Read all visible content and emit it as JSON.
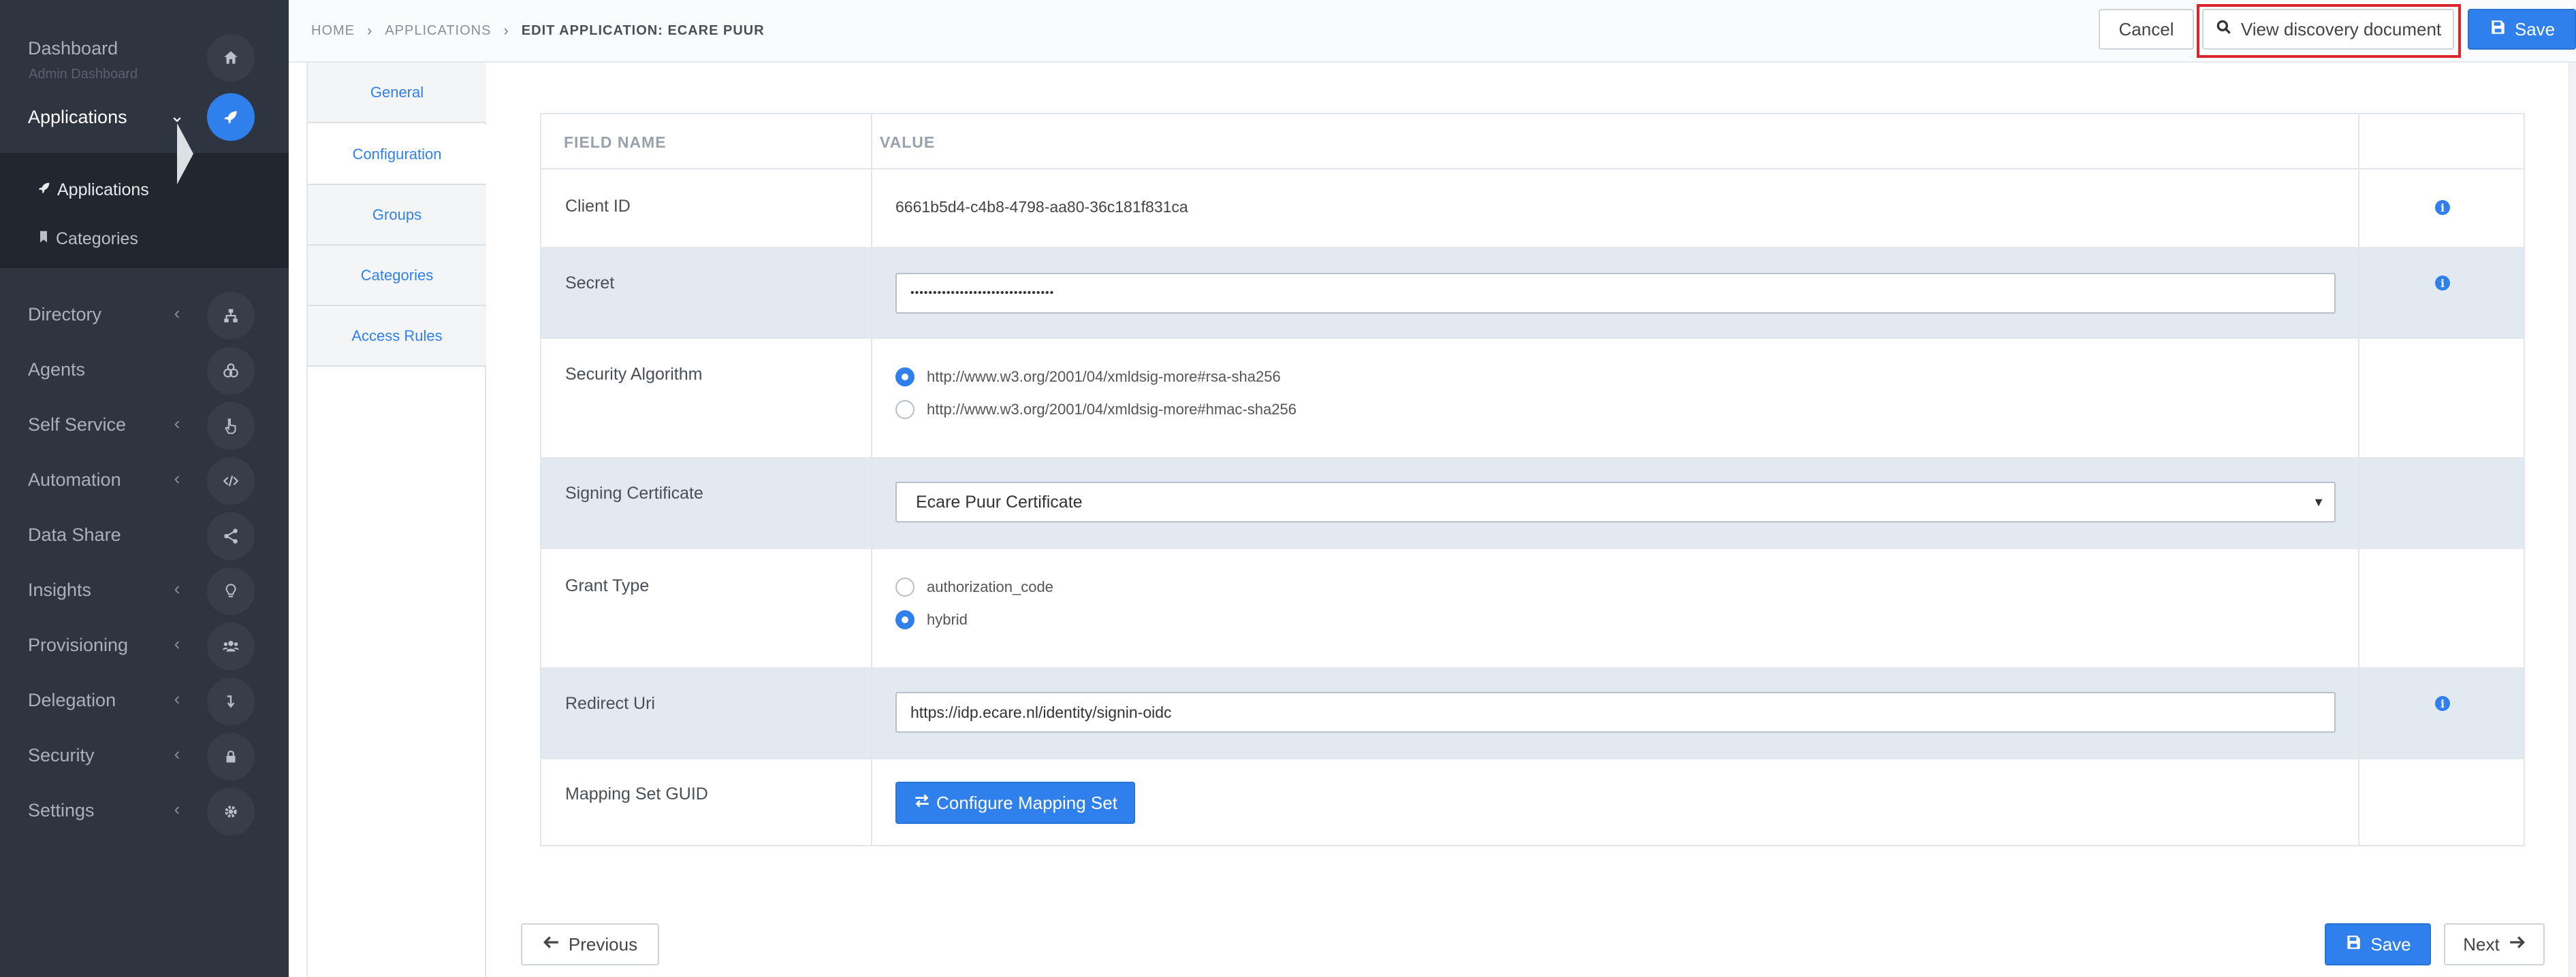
{
  "sidebar": {
    "dashboard": {
      "label": "Dashboard",
      "sub": "Admin Dashboard",
      "icon": "home-icon"
    },
    "applications": {
      "label": "Applications",
      "icon": "rocket-icon"
    },
    "submenu": [
      {
        "label": "Applications",
        "icon": "rocket-icon"
      },
      {
        "label": "Categories",
        "icon": "bookmark-icon"
      }
    ],
    "items": [
      {
        "label": "Directory",
        "icon": "sitemap-icon"
      },
      {
        "label": "Agents",
        "icon": "agents-icon"
      },
      {
        "label": "Self Service",
        "icon": "hand-pointer-icon"
      },
      {
        "label": "Automation",
        "icon": "code-icon"
      },
      {
        "label": "Data Share",
        "icon": "share-icon"
      },
      {
        "label": "Insights",
        "icon": "lightbulb-icon"
      },
      {
        "label": "Provisioning",
        "icon": "users-icon"
      },
      {
        "label": "Delegation",
        "icon": "level-down-icon"
      },
      {
        "label": "Security",
        "icon": "lock-icon"
      },
      {
        "label": "Settings",
        "icon": "gear-icon"
      }
    ]
  },
  "breadcrumb": {
    "home": "HOME",
    "applications": "APPLICATIONS",
    "current": "EDIT APPLICATION: ECARE PUUR"
  },
  "toolbar": {
    "cancel": "Cancel",
    "discovery": "View discovery document",
    "save": "Save"
  },
  "tabs": [
    "General",
    "Configuration",
    "Groups",
    "Categories",
    "Access Rules"
  ],
  "table": {
    "headers": {
      "field": "FIELD NAME",
      "value": "VALUE"
    },
    "client_id": {
      "label": "Client ID",
      "value": "6661b5d4-c4b8-4798-aa80-36c181f831ca"
    },
    "secret": {
      "label": "Secret",
      "value": "••••••••••••••••••••••••••••••••"
    },
    "security_algorithm": {
      "label": "Security Algorithm",
      "options": [
        "http://www.w3.org/2001/04/xmldsig-more#rsa-sha256",
        "http://www.w3.org/2001/04/xmldsig-more#hmac-sha256"
      ],
      "selected": 0
    },
    "signing_certificate": {
      "label": "Signing Certificate",
      "value": "Ecare Puur Certificate"
    },
    "grant_type": {
      "label": "Grant Type",
      "options": [
        "authorization_code",
        "hybrid"
      ],
      "selected": 1
    },
    "redirect_uri": {
      "label": "Redirect Uri",
      "value": "https://idp.ecare.nl/identity/signin-oidc"
    },
    "mapping_set": {
      "label": "Mapping Set GUID",
      "button": "Configure Mapping Set"
    }
  },
  "footer": {
    "previous": "Previous",
    "save": "Save",
    "next": "Next"
  },
  "colors": {
    "accent": "#2f80ed",
    "sidebar_bg": "#2f3540",
    "highlight": "#d9262c"
  }
}
